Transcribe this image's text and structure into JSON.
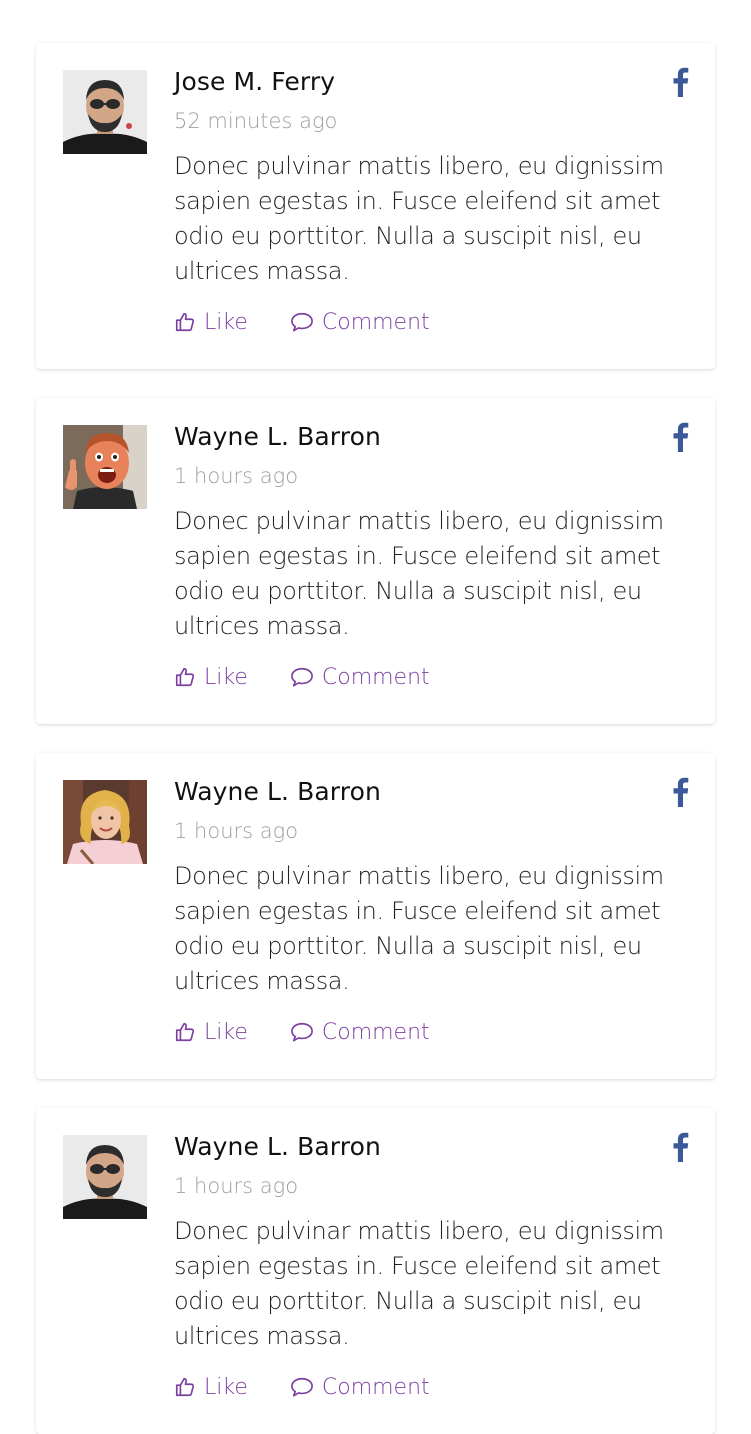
{
  "colors": {
    "accent": "#7b3fa0",
    "facebook": "#3b5998",
    "time": "#9e9e9e",
    "text": "#222222"
  },
  "posts": [
    {
      "author": "Jose M. Ferry",
      "time": "52 minutes ago",
      "text": "Donec pulvinar mattis libero, eu dignissim sapien egestas in. Fusce eleifend sit amet odio eu porttitor. Nulla a suscipit nisl, eu ultrices massa.",
      "like_label": "Like",
      "comment_label": "Comment",
      "network_icon": "facebook-icon"
    },
    {
      "author": "Wayne L. Barron",
      "time": "1 hours ago",
      "text": "Donec pulvinar mattis libero, eu dignissim sapien egestas in. Fusce eleifend sit amet odio eu porttitor. Nulla a suscipit nisl, eu ultrices massa.",
      "like_label": "Like",
      "comment_label": "Comment",
      "network_icon": "facebook-icon"
    },
    {
      "author": "Wayne L. Barron",
      "time": "1 hours ago",
      "text": "Donec pulvinar mattis libero, eu dignissim sapien egestas in. Fusce eleifend sit amet odio eu porttitor. Nulla a suscipit nisl, eu ultrices massa.",
      "like_label": "Like",
      "comment_label": "Comment",
      "network_icon": "facebook-icon"
    },
    {
      "author": "Wayne L. Barron",
      "time": "1 hours ago",
      "text": "Donec pulvinar mattis libero, eu dignissim sapien egestas in. Fusce eleifend sit amet odio eu porttitor. Nulla a suscipit nisl, eu ultrices massa.",
      "like_label": "Like",
      "comment_label": "Comment",
      "network_icon": "facebook-icon"
    }
  ]
}
